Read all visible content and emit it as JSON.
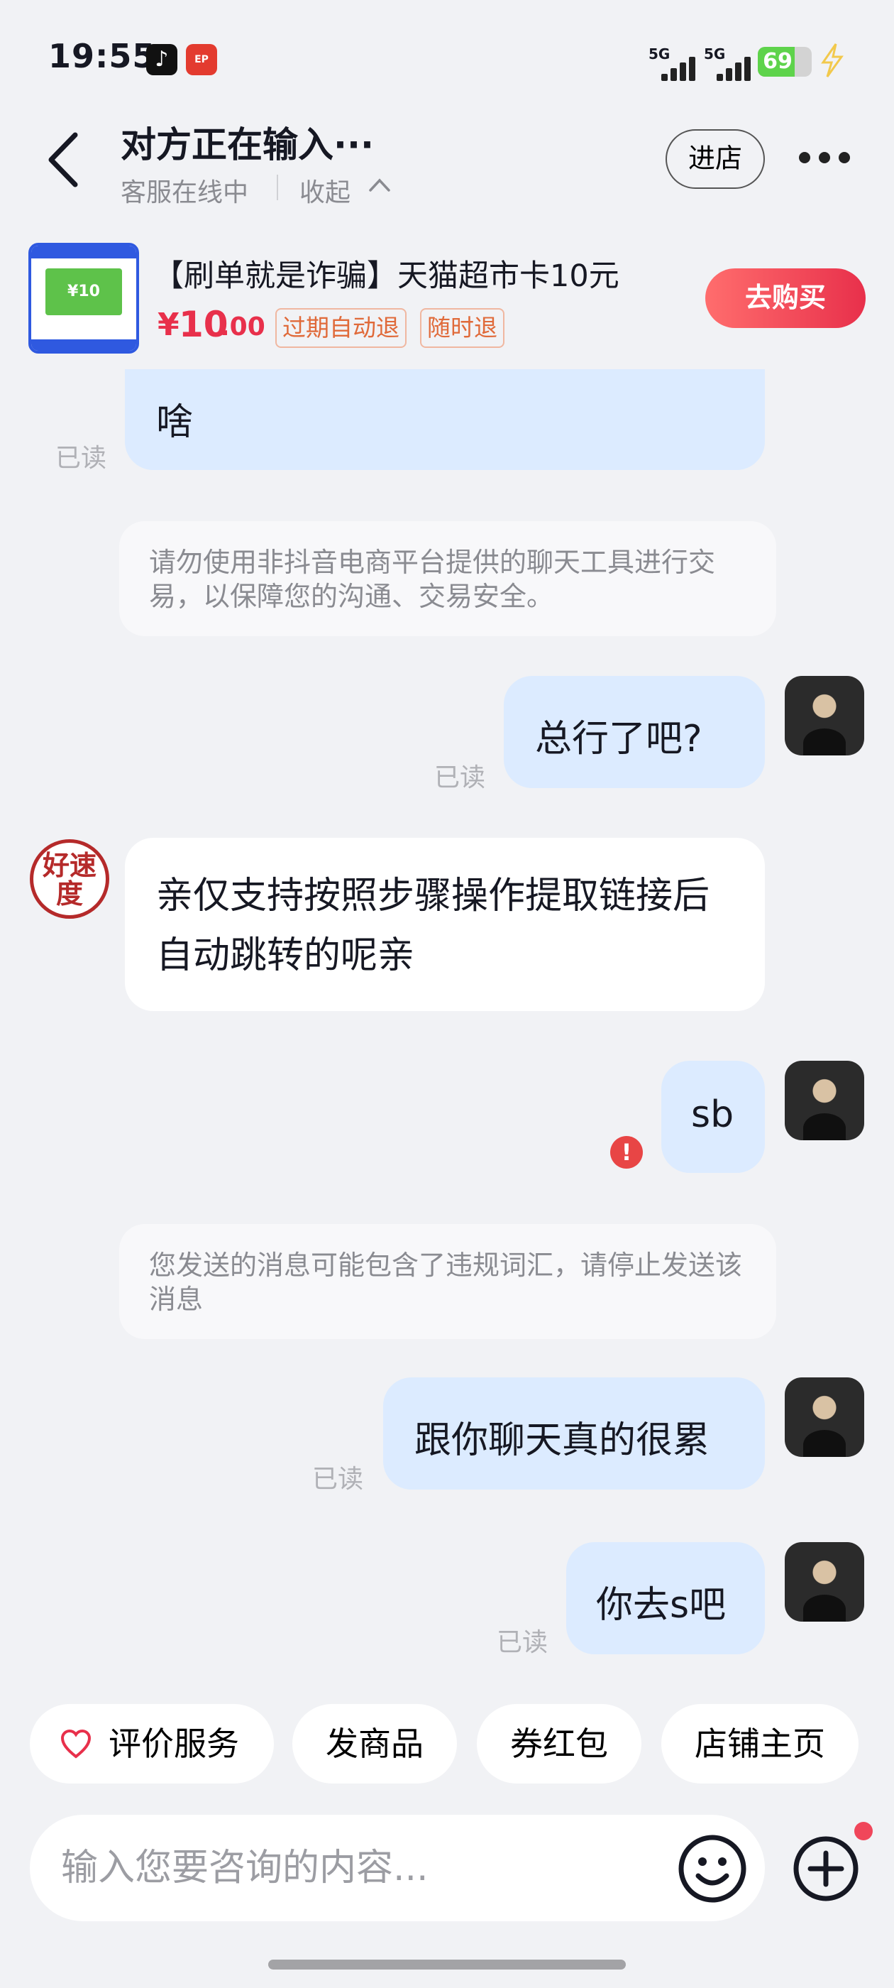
{
  "status_bar": {
    "time": "19:55",
    "app_icon_2": "EP",
    "signal_1": "5G",
    "signal_2": "5G",
    "battery": "69",
    "battery_level": 0.69
  },
  "header": {
    "title": "对方正在输入···",
    "subtitle": "客服在线中",
    "collapse_label": "收起",
    "enter_store_label": "进店"
  },
  "product": {
    "image_badge": "¥10",
    "title": "【刷单就是诈骗】天猫超市卡10元",
    "price_symbol": "¥",
    "price_int": "10",
    "price_dec": ".00",
    "tags": [
      "过期自动退",
      "随时退"
    ],
    "buy_label": "去购买"
  },
  "messages": {
    "m1_text": "啥",
    "m1_status": "已读",
    "sys1": "请勿使用非抖音电商平台提供的聊天工具进行交易，以保障您的沟通、交易安全。",
    "m2_text": "总行了吧?",
    "m2_status": "已读",
    "seller_avatar_text": "好速度",
    "m3_text": "亲仅支持按照步骤操作提取链接后自动跳转的呢亲",
    "m4_text": "sb",
    "error_mark": "!",
    "sys2": "您发送的消息可能包含了违规词汇，请停止发送该消息",
    "m5_text": "跟你聊天真的很累",
    "m5_status": "已读",
    "m6_text": "你去s吧",
    "m6_status": "已读"
  },
  "quick_actions": [
    "评价服务",
    "发商品",
    "券红包",
    "店铺主页"
  ],
  "input": {
    "placeholder": "输入您要咨询的内容..."
  },
  "colors": {
    "accent_red": "#e8304b",
    "bubble_blue": "#dcebff",
    "tag_orange": "#e06a3a"
  }
}
